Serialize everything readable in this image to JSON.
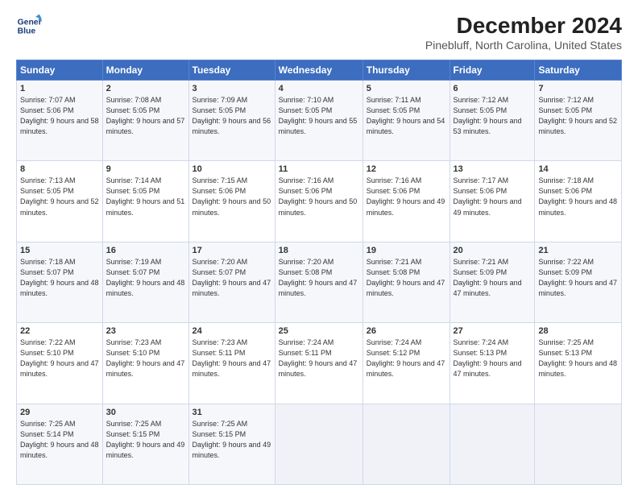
{
  "logo": {
    "line1": "General",
    "line2": "Blue"
  },
  "title": "December 2024",
  "subtitle": "Pinebluff, North Carolina, United States",
  "weekdays": [
    "Sunday",
    "Monday",
    "Tuesday",
    "Wednesday",
    "Thursday",
    "Friday",
    "Saturday"
  ],
  "weeks": [
    [
      {
        "day": "1",
        "rise": "Sunrise: 7:07 AM",
        "set": "Sunset: 5:06 PM",
        "light": "Daylight: 9 hours and 58 minutes."
      },
      {
        "day": "2",
        "rise": "Sunrise: 7:08 AM",
        "set": "Sunset: 5:05 PM",
        "light": "Daylight: 9 hours and 57 minutes."
      },
      {
        "day": "3",
        "rise": "Sunrise: 7:09 AM",
        "set": "Sunset: 5:05 PM",
        "light": "Daylight: 9 hours and 56 minutes."
      },
      {
        "day": "4",
        "rise": "Sunrise: 7:10 AM",
        "set": "Sunset: 5:05 PM",
        "light": "Daylight: 9 hours and 55 minutes."
      },
      {
        "day": "5",
        "rise": "Sunrise: 7:11 AM",
        "set": "Sunset: 5:05 PM",
        "light": "Daylight: 9 hours and 54 minutes."
      },
      {
        "day": "6",
        "rise": "Sunrise: 7:12 AM",
        "set": "Sunset: 5:05 PM",
        "light": "Daylight: 9 hours and 53 minutes."
      },
      {
        "day": "7",
        "rise": "Sunrise: 7:12 AM",
        "set": "Sunset: 5:05 PM",
        "light": "Daylight: 9 hours and 52 minutes."
      }
    ],
    [
      {
        "day": "8",
        "rise": "Sunrise: 7:13 AM",
        "set": "Sunset: 5:05 PM",
        "light": "Daylight: 9 hours and 52 minutes."
      },
      {
        "day": "9",
        "rise": "Sunrise: 7:14 AM",
        "set": "Sunset: 5:05 PM",
        "light": "Daylight: 9 hours and 51 minutes."
      },
      {
        "day": "10",
        "rise": "Sunrise: 7:15 AM",
        "set": "Sunset: 5:06 PM",
        "light": "Daylight: 9 hours and 50 minutes."
      },
      {
        "day": "11",
        "rise": "Sunrise: 7:16 AM",
        "set": "Sunset: 5:06 PM",
        "light": "Daylight: 9 hours and 50 minutes."
      },
      {
        "day": "12",
        "rise": "Sunrise: 7:16 AM",
        "set": "Sunset: 5:06 PM",
        "light": "Daylight: 9 hours and 49 minutes."
      },
      {
        "day": "13",
        "rise": "Sunrise: 7:17 AM",
        "set": "Sunset: 5:06 PM",
        "light": "Daylight: 9 hours and 49 minutes."
      },
      {
        "day": "14",
        "rise": "Sunrise: 7:18 AM",
        "set": "Sunset: 5:06 PM",
        "light": "Daylight: 9 hours and 48 minutes."
      }
    ],
    [
      {
        "day": "15",
        "rise": "Sunrise: 7:18 AM",
        "set": "Sunset: 5:07 PM",
        "light": "Daylight: 9 hours and 48 minutes."
      },
      {
        "day": "16",
        "rise": "Sunrise: 7:19 AM",
        "set": "Sunset: 5:07 PM",
        "light": "Daylight: 9 hours and 48 minutes."
      },
      {
        "day": "17",
        "rise": "Sunrise: 7:20 AM",
        "set": "Sunset: 5:07 PM",
        "light": "Daylight: 9 hours and 47 minutes."
      },
      {
        "day": "18",
        "rise": "Sunrise: 7:20 AM",
        "set": "Sunset: 5:08 PM",
        "light": "Daylight: 9 hours and 47 minutes."
      },
      {
        "day": "19",
        "rise": "Sunrise: 7:21 AM",
        "set": "Sunset: 5:08 PM",
        "light": "Daylight: 9 hours and 47 minutes."
      },
      {
        "day": "20",
        "rise": "Sunrise: 7:21 AM",
        "set": "Sunset: 5:09 PM",
        "light": "Daylight: 9 hours and 47 minutes."
      },
      {
        "day": "21",
        "rise": "Sunrise: 7:22 AM",
        "set": "Sunset: 5:09 PM",
        "light": "Daylight: 9 hours and 47 minutes."
      }
    ],
    [
      {
        "day": "22",
        "rise": "Sunrise: 7:22 AM",
        "set": "Sunset: 5:10 PM",
        "light": "Daylight: 9 hours and 47 minutes."
      },
      {
        "day": "23",
        "rise": "Sunrise: 7:23 AM",
        "set": "Sunset: 5:10 PM",
        "light": "Daylight: 9 hours and 47 minutes."
      },
      {
        "day": "24",
        "rise": "Sunrise: 7:23 AM",
        "set": "Sunset: 5:11 PM",
        "light": "Daylight: 9 hours and 47 minutes."
      },
      {
        "day": "25",
        "rise": "Sunrise: 7:24 AM",
        "set": "Sunset: 5:11 PM",
        "light": "Daylight: 9 hours and 47 minutes."
      },
      {
        "day": "26",
        "rise": "Sunrise: 7:24 AM",
        "set": "Sunset: 5:12 PM",
        "light": "Daylight: 9 hours and 47 minutes."
      },
      {
        "day": "27",
        "rise": "Sunrise: 7:24 AM",
        "set": "Sunset: 5:13 PM",
        "light": "Daylight: 9 hours and 47 minutes."
      },
      {
        "day": "28",
        "rise": "Sunrise: 7:25 AM",
        "set": "Sunset: 5:13 PM",
        "light": "Daylight: 9 hours and 48 minutes."
      }
    ],
    [
      {
        "day": "29",
        "rise": "Sunrise: 7:25 AM",
        "set": "Sunset: 5:14 PM",
        "light": "Daylight: 9 hours and 48 minutes."
      },
      {
        "day": "30",
        "rise": "Sunrise: 7:25 AM",
        "set": "Sunset: 5:15 PM",
        "light": "Daylight: 9 hours and 49 minutes."
      },
      {
        "day": "31",
        "rise": "Sunrise: 7:25 AM",
        "set": "Sunset: 5:15 PM",
        "light": "Daylight: 9 hours and 49 minutes."
      },
      null,
      null,
      null,
      null
    ]
  ]
}
